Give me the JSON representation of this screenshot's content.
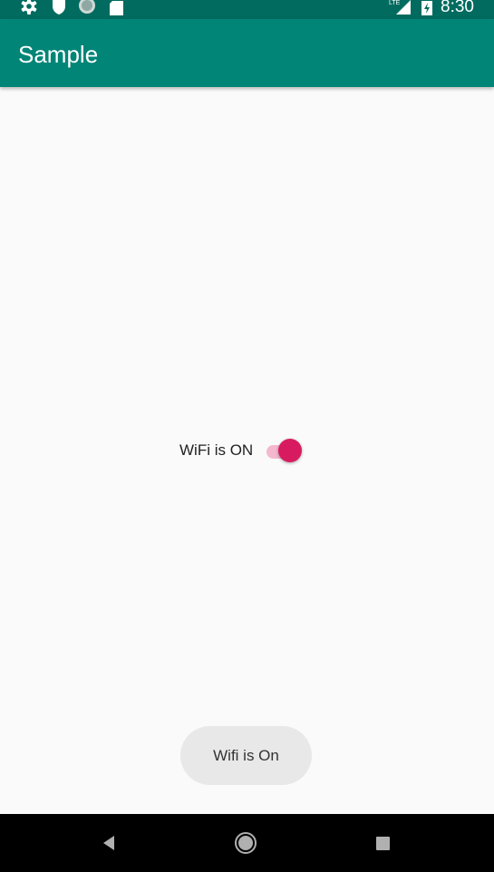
{
  "status_bar": {
    "time": "8:30",
    "left_icons": [
      "settings-icon",
      "shield-icon",
      "sync-circle-icon",
      "sd-card-icon"
    ],
    "right_icons": [
      "lte-signal-icon",
      "battery-charging-icon"
    ]
  },
  "app_bar": {
    "title": "Sample",
    "color": "#008577"
  },
  "main": {
    "switch_label": "WiFi is ON",
    "switch_checked": true,
    "accent_color": "#D81B60"
  },
  "toast": {
    "message": "Wifi is On"
  },
  "nav_bar": {
    "buttons": [
      "back-icon",
      "home-icon",
      "recents-icon"
    ]
  }
}
